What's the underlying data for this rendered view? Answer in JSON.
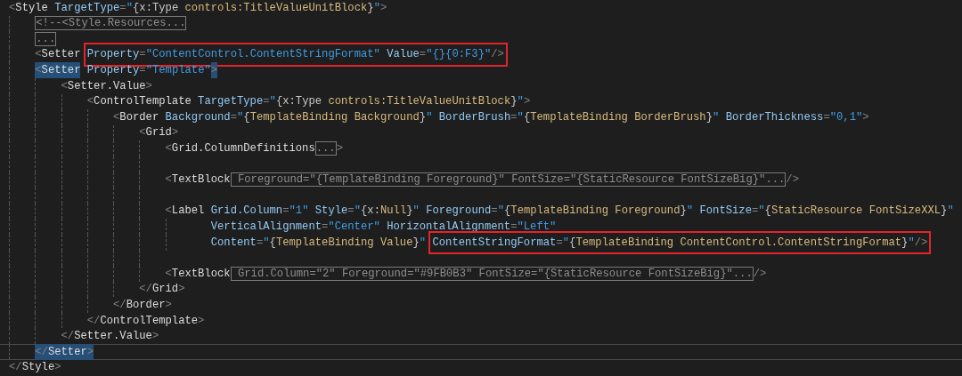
{
  "editor": {
    "lines": [
      {
        "current": false,
        "segments": [
          {
            "kind": "code",
            "tokens": [
              {
                "kind": "p",
                "text": "<"
              },
              {
                "kind": "t",
                "text": "Style"
              },
              {
                "kind": "a",
                "text": " TargetType"
              },
              {
                "kind": "p",
                "text": "="
              },
              {
                "kind": "s",
                "text": "\""
              },
              {
                "kind": "x",
                "text": "{x:Type "
              },
              {
                "kind": "m",
                "text": "controls:TitleValueUnitBlock"
              },
              {
                "kind": "x",
                "text": "}"
              },
              {
                "kind": "s",
                "text": "\""
              },
              {
                "kind": "p",
                "text": ">"
              }
            ]
          }
        ],
        "children": [
          {
            "current": false,
            "segments": [
              {
                "kind": "fold",
                "text": "<!--<Style.Resources..."
              }
            ]
          },
          {
            "current": false,
            "segments": [
              {
                "kind": "fold",
                "text": "..."
              }
            ]
          },
          {
            "current": false,
            "segments": [
              {
                "kind": "code",
                "tokens": [
                  {
                    "kind": "p",
                    "text": "<"
                  },
                  {
                    "kind": "t",
                    "text": "Setter "
                  }
                ]
              },
              {
                "kind": "box",
                "tokens": [
                  {
                    "kind": "a",
                    "text": "Property"
                  },
                  {
                    "kind": "p",
                    "text": "="
                  },
                  {
                    "kind": "s",
                    "text": "\"ContentControl.ContentStringFormat\""
                  },
                  {
                    "kind": "a",
                    "text": " Value"
                  },
                  {
                    "kind": "p",
                    "text": "="
                  },
                  {
                    "kind": "s",
                    "text": "\"{}{0:F3}\""
                  },
                  {
                    "kind": "p",
                    "text": "/>"
                  }
                ]
              }
            ]
          },
          {
            "current": false,
            "segments": [
              {
                "kind": "match",
                "tokens": [
                  {
                    "kind": "p",
                    "text": "<"
                  },
                  {
                    "kind": "t",
                    "text": "Setter"
                  }
                ]
              },
              {
                "kind": "code",
                "tokens": [
                  {
                    "kind": "a",
                    "text": " Property"
                  },
                  {
                    "kind": "p",
                    "text": "="
                  },
                  {
                    "kind": "s",
                    "text": "\"Template\""
                  }
                ]
              },
              {
                "kind": "match",
                "tokens": [
                  {
                    "kind": "p",
                    "text": ">"
                  }
                ]
              }
            ],
            "children": [
              {
                "current": false,
                "segments": [
                  {
                    "kind": "code",
                    "tokens": [
                      {
                        "kind": "p",
                        "text": "<"
                      },
                      {
                        "kind": "t",
                        "text": "Setter.Value"
                      },
                      {
                        "kind": "p",
                        "text": ">"
                      }
                    ]
                  }
                ],
                "children": [
                  {
                    "current": false,
                    "segments": [
                      {
                        "kind": "code",
                        "tokens": [
                          {
                            "kind": "p",
                            "text": "<"
                          },
                          {
                            "kind": "t",
                            "text": "ControlTemplate"
                          },
                          {
                            "kind": "a",
                            "text": " TargetType"
                          },
                          {
                            "kind": "p",
                            "text": "="
                          },
                          {
                            "kind": "s",
                            "text": "\""
                          },
                          {
                            "kind": "x",
                            "text": "{x:Type "
                          },
                          {
                            "kind": "m",
                            "text": "controls:TitleValueUnitBlock"
                          },
                          {
                            "kind": "x",
                            "text": "}"
                          },
                          {
                            "kind": "s",
                            "text": "\""
                          },
                          {
                            "kind": "p",
                            "text": ">"
                          }
                        ]
                      }
                    ],
                    "children": [
                      {
                        "current": false,
                        "segments": [
                          {
                            "kind": "code",
                            "tokens": [
                              {
                                "kind": "p",
                                "text": "<"
                              },
                              {
                                "kind": "t",
                                "text": "Border"
                              },
                              {
                                "kind": "a",
                                "text": " Background"
                              },
                              {
                                "kind": "p",
                                "text": "="
                              },
                              {
                                "kind": "s",
                                "text": "\""
                              },
                              {
                                "kind": "x",
                                "text": "{"
                              },
                              {
                                "kind": "m",
                                "text": "TemplateBinding Background"
                              },
                              {
                                "kind": "x",
                                "text": "}"
                              },
                              {
                                "kind": "s",
                                "text": "\""
                              },
                              {
                                "kind": "a",
                                "text": " BorderBrush"
                              },
                              {
                                "kind": "p",
                                "text": "="
                              },
                              {
                                "kind": "s",
                                "text": "\""
                              },
                              {
                                "kind": "x",
                                "text": "{"
                              },
                              {
                                "kind": "m",
                                "text": "TemplateBinding BorderBrush"
                              },
                              {
                                "kind": "x",
                                "text": "}"
                              },
                              {
                                "kind": "s",
                                "text": "\""
                              },
                              {
                                "kind": "a",
                                "text": " BorderThickness"
                              },
                              {
                                "kind": "p",
                                "text": "="
                              },
                              {
                                "kind": "s",
                                "text": "\"0,1\""
                              },
                              {
                                "kind": "p",
                                "text": ">"
                              }
                            ]
                          }
                        ],
                        "children": [
                          {
                            "current": false,
                            "segments": [
                              {
                                "kind": "code",
                                "tokens": [
                                  {
                                    "kind": "p",
                                    "text": "<"
                                  },
                                  {
                                    "kind": "t",
                                    "text": "Grid"
                                  },
                                  {
                                    "kind": "p",
                                    "text": ">"
                                  }
                                ]
                              }
                            ],
                            "children": [
                              {
                                "current": false,
                                "blank_before": false,
                                "segments": [
                                  {
                                    "kind": "code",
                                    "tokens": [
                                      {
                                        "kind": "p",
                                        "text": "<"
                                      },
                                      {
                                        "kind": "t",
                                        "text": "Grid.ColumnDefinitions"
                                      }
                                    ]
                                  },
                                  {
                                    "kind": "fold",
                                    "text": "..."
                                  },
                                  {
                                    "kind": "code",
                                    "tokens": [
                                      {
                                        "kind": "p",
                                        "text": ">"
                                      }
                                    ]
                                  }
                                ]
                              },
                              {
                                "current": false,
                                "blank_before": true,
                                "segments": [
                                  {
                                    "kind": "code",
                                    "tokens": [
                                      {
                                        "kind": "p",
                                        "text": "<"
                                      },
                                      {
                                        "kind": "t",
                                        "text": "TextBlock"
                                      }
                                    ]
                                  },
                                  {
                                    "kind": "fold",
                                    "text": " Foreground=\"{TemplateBinding Foreground}\" FontSize=\"{StaticResource FontSizeBig}\"..."
                                  },
                                  {
                                    "kind": "code",
                                    "tokens": [
                                      {
                                        "kind": "p",
                                        "text": "/>"
                                      }
                                    ]
                                  }
                                ]
                              },
                              {
                                "current": false,
                                "blank_before": true,
                                "segments": [
                                  {
                                    "kind": "code",
                                    "tokens": [
                                      {
                                        "kind": "p",
                                        "text": "<"
                                      },
                                      {
                                        "kind": "t",
                                        "text": "Label"
                                      },
                                      {
                                        "kind": "a",
                                        "text": " Grid.Column"
                                      },
                                      {
                                        "kind": "p",
                                        "text": "="
                                      },
                                      {
                                        "kind": "s",
                                        "text": "\"1\""
                                      },
                                      {
                                        "kind": "a",
                                        "text": " Style"
                                      },
                                      {
                                        "kind": "p",
                                        "text": "="
                                      },
                                      {
                                        "kind": "s",
                                        "text": "\""
                                      },
                                      {
                                        "kind": "x",
                                        "text": "{x:"
                                      },
                                      {
                                        "kind": "m",
                                        "text": "Null"
                                      },
                                      {
                                        "kind": "x",
                                        "text": "}"
                                      },
                                      {
                                        "kind": "s",
                                        "text": "\""
                                      },
                                      {
                                        "kind": "a",
                                        "text": " Foreground"
                                      },
                                      {
                                        "kind": "p",
                                        "text": "="
                                      },
                                      {
                                        "kind": "s",
                                        "text": "\""
                                      },
                                      {
                                        "kind": "x",
                                        "text": "{"
                                      },
                                      {
                                        "kind": "m",
                                        "text": "TemplateBinding Foreground"
                                      },
                                      {
                                        "kind": "x",
                                        "text": "}"
                                      },
                                      {
                                        "kind": "s",
                                        "text": "\""
                                      },
                                      {
                                        "kind": "a",
                                        "text": " FontSize"
                                      },
                                      {
                                        "kind": "p",
                                        "text": "="
                                      },
                                      {
                                        "kind": "s",
                                        "text": "\""
                                      },
                                      {
                                        "kind": "x",
                                        "text": "{"
                                      },
                                      {
                                        "kind": "m",
                                        "text": "StaticResource FontSizeXXL"
                                      },
                                      {
                                        "kind": "x",
                                        "text": "}"
                                      },
                                      {
                                        "kind": "s",
                                        "text": "\""
                                      }
                                    ]
                                  }
                                ],
                                "continued": [
                                  {
                                    "current": false,
                                    "segments": [
                                      {
                                        "kind": "code",
                                        "tokens": [
                                          {
                                            "kind": "a",
                                            "text": "VerticalAlignment"
                                          },
                                          {
                                            "kind": "p",
                                            "text": "="
                                          },
                                          {
                                            "kind": "s",
                                            "text": "\"Center\""
                                          },
                                          {
                                            "kind": "a",
                                            "text": " HorizontalAlignment"
                                          },
                                          {
                                            "kind": "p",
                                            "text": "="
                                          },
                                          {
                                            "kind": "s",
                                            "text": "\"Left\""
                                          }
                                        ]
                                      }
                                    ]
                                  },
                                  {
                                    "current": false,
                                    "segments": [
                                      {
                                        "kind": "code",
                                        "tokens": [
                                          {
                                            "kind": "a",
                                            "text": "Content"
                                          },
                                          {
                                            "kind": "p",
                                            "text": "="
                                          },
                                          {
                                            "kind": "s",
                                            "text": "\""
                                          },
                                          {
                                            "kind": "x",
                                            "text": "{"
                                          },
                                          {
                                            "kind": "m",
                                            "text": "TemplateBinding Value"
                                          },
                                          {
                                            "kind": "x",
                                            "text": "}"
                                          },
                                          {
                                            "kind": "s",
                                            "text": "\" "
                                          }
                                        ]
                                      },
                                      {
                                        "kind": "box",
                                        "tokens": [
                                          {
                                            "kind": "a",
                                            "text": "ContentStringFormat"
                                          },
                                          {
                                            "kind": "p",
                                            "text": "="
                                          },
                                          {
                                            "kind": "s",
                                            "text": "\""
                                          },
                                          {
                                            "kind": "x",
                                            "text": "{"
                                          },
                                          {
                                            "kind": "m",
                                            "text": "TemplateBinding ContentControl.ContentStringFormat"
                                          },
                                          {
                                            "kind": "x",
                                            "text": "}"
                                          },
                                          {
                                            "kind": "s",
                                            "text": "\""
                                          },
                                          {
                                            "kind": "p",
                                            "text": "/>"
                                          }
                                        ]
                                      }
                                    ]
                                  }
                                ]
                              },
                              {
                                "current": false,
                                "blank_before": true,
                                "segments": [
                                  {
                                    "kind": "code",
                                    "tokens": [
                                      {
                                        "kind": "p",
                                        "text": "<"
                                      },
                                      {
                                        "kind": "t",
                                        "text": "TextBlock"
                                      }
                                    ]
                                  },
                                  {
                                    "kind": "fold",
                                    "text": " Grid.Column=\"2\" Foreground=\"#9FB0B3\" FontSize=\"{StaticResource FontSizeBig}\"..."
                                  },
                                  {
                                    "kind": "code",
                                    "tokens": [
                                      {
                                        "kind": "p",
                                        "text": "/>"
                                      }
                                    ]
                                  }
                                ]
                              }
                            ],
                            "closing": {
                              "current": false,
                              "segments": [
                                {
                                  "kind": "code",
                                  "tokens": [
                                    {
                                      "kind": "p",
                                      "text": "</"
                                    },
                                    {
                                      "kind": "t",
                                      "text": "Grid"
                                    },
                                    {
                                      "kind": "p",
                                      "text": ">"
                                    }
                                  ]
                                }
                              ]
                            }
                          }
                        ],
                        "closing": {
                          "current": false,
                          "segments": [
                            {
                              "kind": "code",
                              "tokens": [
                                {
                                  "kind": "p",
                                  "text": "</"
                                },
                                {
                                  "kind": "t",
                                  "text": "Border"
                                },
                                {
                                  "kind": "p",
                                  "text": ">"
                                }
                              ]
                            }
                          ]
                        }
                      }
                    ],
                    "closing": {
                      "current": false,
                      "segments": [
                        {
                          "kind": "code",
                          "tokens": [
                            {
                              "kind": "p",
                              "text": "</"
                            },
                            {
                              "kind": "t",
                              "text": "ControlTemplate"
                            },
                            {
                              "kind": "p",
                              "text": ">"
                            }
                          ]
                        }
                      ]
                    }
                  }
                ],
                "closing": {
                  "current": false,
                  "segments": [
                    {
                      "kind": "code",
                      "tokens": [
                        {
                          "kind": "p",
                          "text": "</"
                        },
                        {
                          "kind": "t",
                          "text": "Setter.Value"
                        },
                        {
                          "kind": "p",
                          "text": ">"
                        }
                      ]
                    }
                  ]
                }
              }
            ],
            "closing": {
              "current": true,
              "segments": [
                {
                  "kind": "match",
                  "tokens": [
                    {
                      "kind": "p",
                      "text": "</"
                    },
                    {
                      "kind": "t",
                      "text": "Setter"
                    },
                    {
                      "kind": "p",
                      "text": ">"
                    }
                  ]
                }
              ]
            }
          }
        ],
        "closing": {
          "current": false,
          "segments": [
            {
              "kind": "code",
              "tokens": [
                {
                  "kind": "p",
                  "text": "</"
                },
                {
                  "kind": "t",
                  "text": "Style"
                },
                {
                  "kind": "p",
                  "text": ">"
                }
              ]
            }
          ]
        }
      }
    ]
  }
}
